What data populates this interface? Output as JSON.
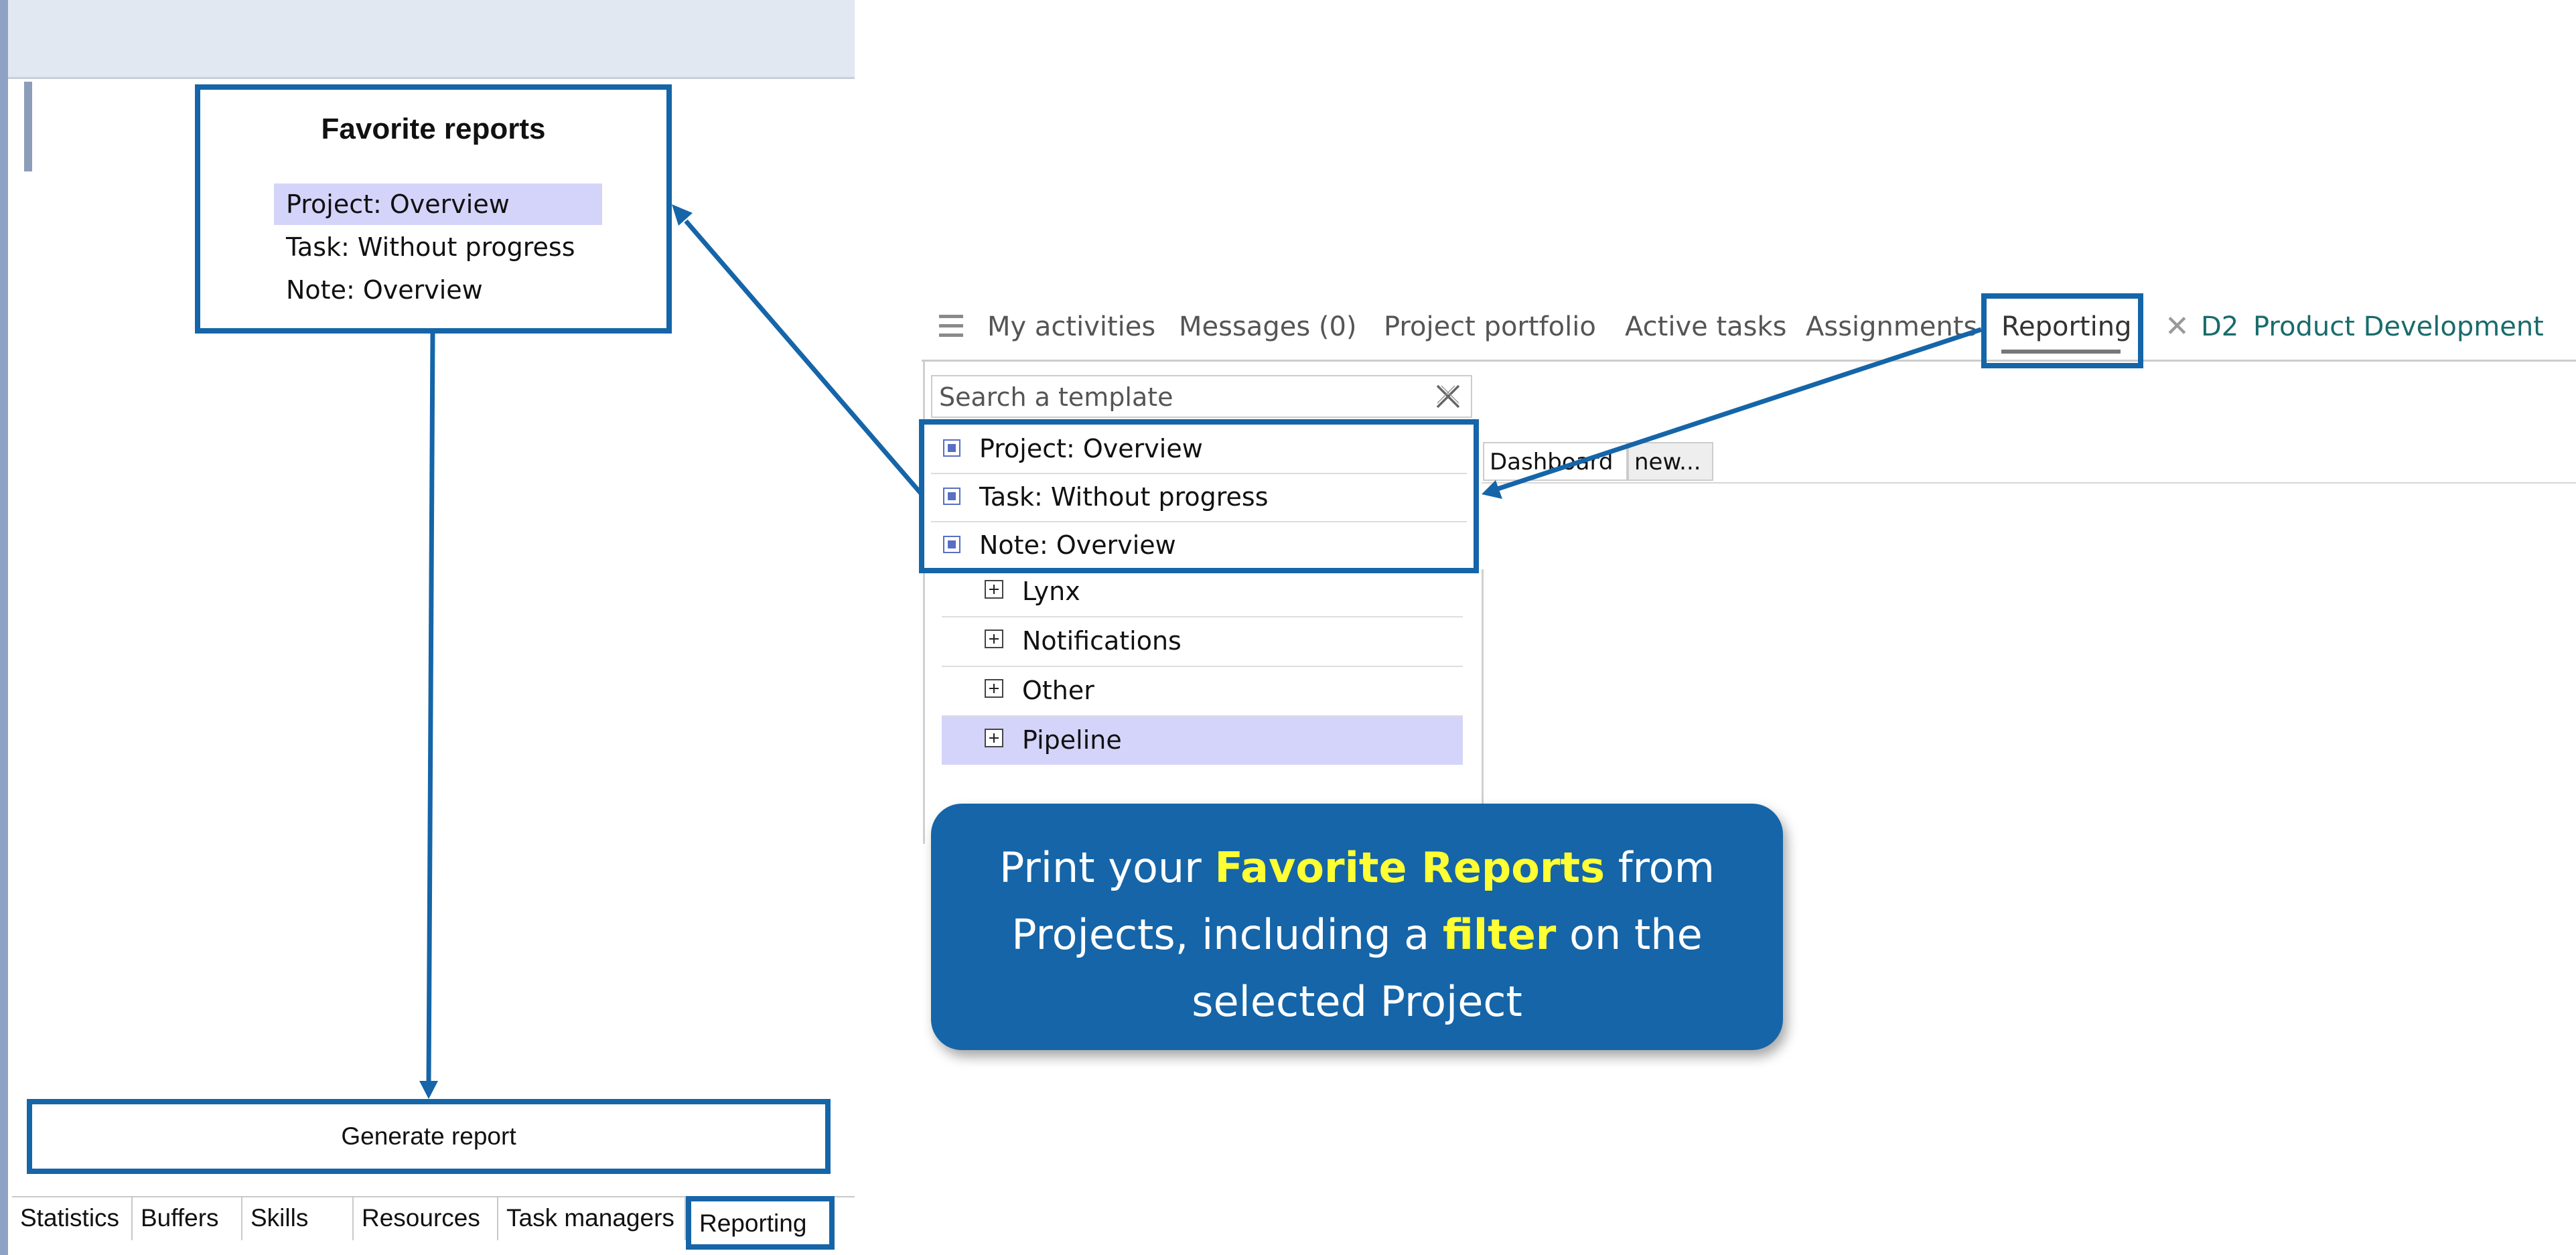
{
  "favorites": {
    "title": "Favorite reports",
    "items": [
      "Project: Overview",
      "Task: Without progress",
      "Note: Overview"
    ]
  },
  "generate_button": "Generate report",
  "bottom_tabs": [
    "Statistics",
    "Buffers",
    "Skills",
    "Resources",
    "Task managers",
    "Reporting"
  ],
  "nav": {
    "items": [
      "My activities",
      "Messages (0)",
      "Project portfolio",
      "Active tasks",
      "Assignments",
      "Reporting"
    ],
    "project_code": "D2",
    "project_name": "Product Development"
  },
  "search": {
    "placeholder": "Search a template"
  },
  "templates": [
    "Project: Overview",
    "Task: Without progress",
    "Note: Overview"
  ],
  "groups": [
    "Lynx",
    "Notifications",
    "Other",
    "Pipeline"
  ],
  "sub_tabs": [
    "Dashboard",
    "new..."
  ],
  "callout": {
    "t1": "Print your ",
    "h1": "Favorite Reports",
    "t2": " from Projects, including a ",
    "h2": "filter",
    "t3": " on the selected Project"
  },
  "colors": {
    "accent": "#1565a8",
    "highlight": "#ffff33",
    "selection": "#d4d4fa"
  }
}
